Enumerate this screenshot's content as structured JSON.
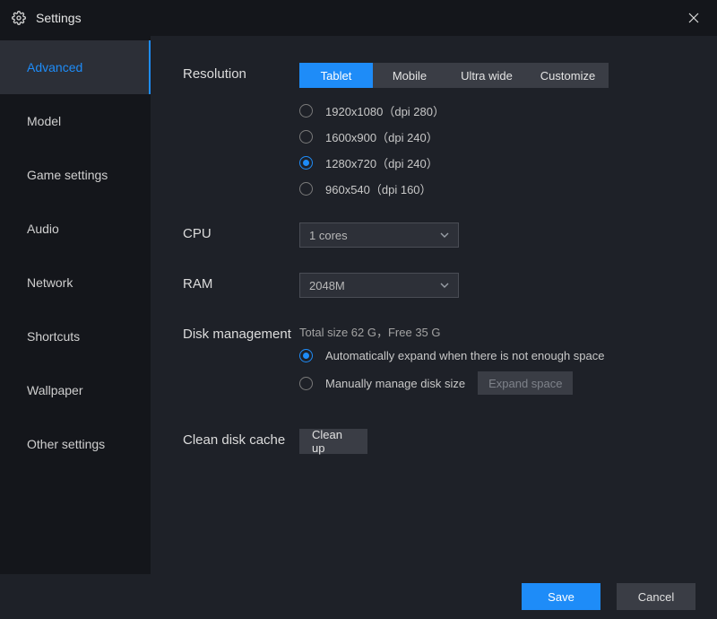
{
  "window": {
    "title": "Settings"
  },
  "sidebar": {
    "items": [
      {
        "label": "Advanced",
        "active": true
      },
      {
        "label": "Model"
      },
      {
        "label": "Game settings"
      },
      {
        "label": "Audio"
      },
      {
        "label": "Network"
      },
      {
        "label": "Shortcuts"
      },
      {
        "label": "Wallpaper"
      },
      {
        "label": "Other settings"
      }
    ]
  },
  "resolution": {
    "label": "Resolution",
    "tabs": [
      "Tablet",
      "Mobile",
      "Ultra wide",
      "Customize"
    ],
    "active_tab": 0,
    "options": [
      {
        "text": "1920x1080（dpi 280）",
        "selected": false
      },
      {
        "text": "1600x900（dpi 240）",
        "selected": false
      },
      {
        "text": "1280x720（dpi 240）",
        "selected": true
      },
      {
        "text": "960x540（dpi 160）",
        "selected": false
      }
    ]
  },
  "cpu": {
    "label": "CPU",
    "value": "1 cores"
  },
  "ram": {
    "label": "RAM",
    "value": "2048M"
  },
  "disk": {
    "label": "Disk management",
    "info": "Total size 62 G，Free 35 G",
    "auto": {
      "text": "Automatically expand when there is not enough space",
      "selected": true
    },
    "manual": {
      "text": "Manually manage disk size",
      "selected": false
    },
    "expand_btn": "Expand space"
  },
  "clean": {
    "label": "Clean disk cache",
    "button": "Clean up"
  },
  "footer": {
    "save": "Save",
    "cancel": "Cancel"
  }
}
